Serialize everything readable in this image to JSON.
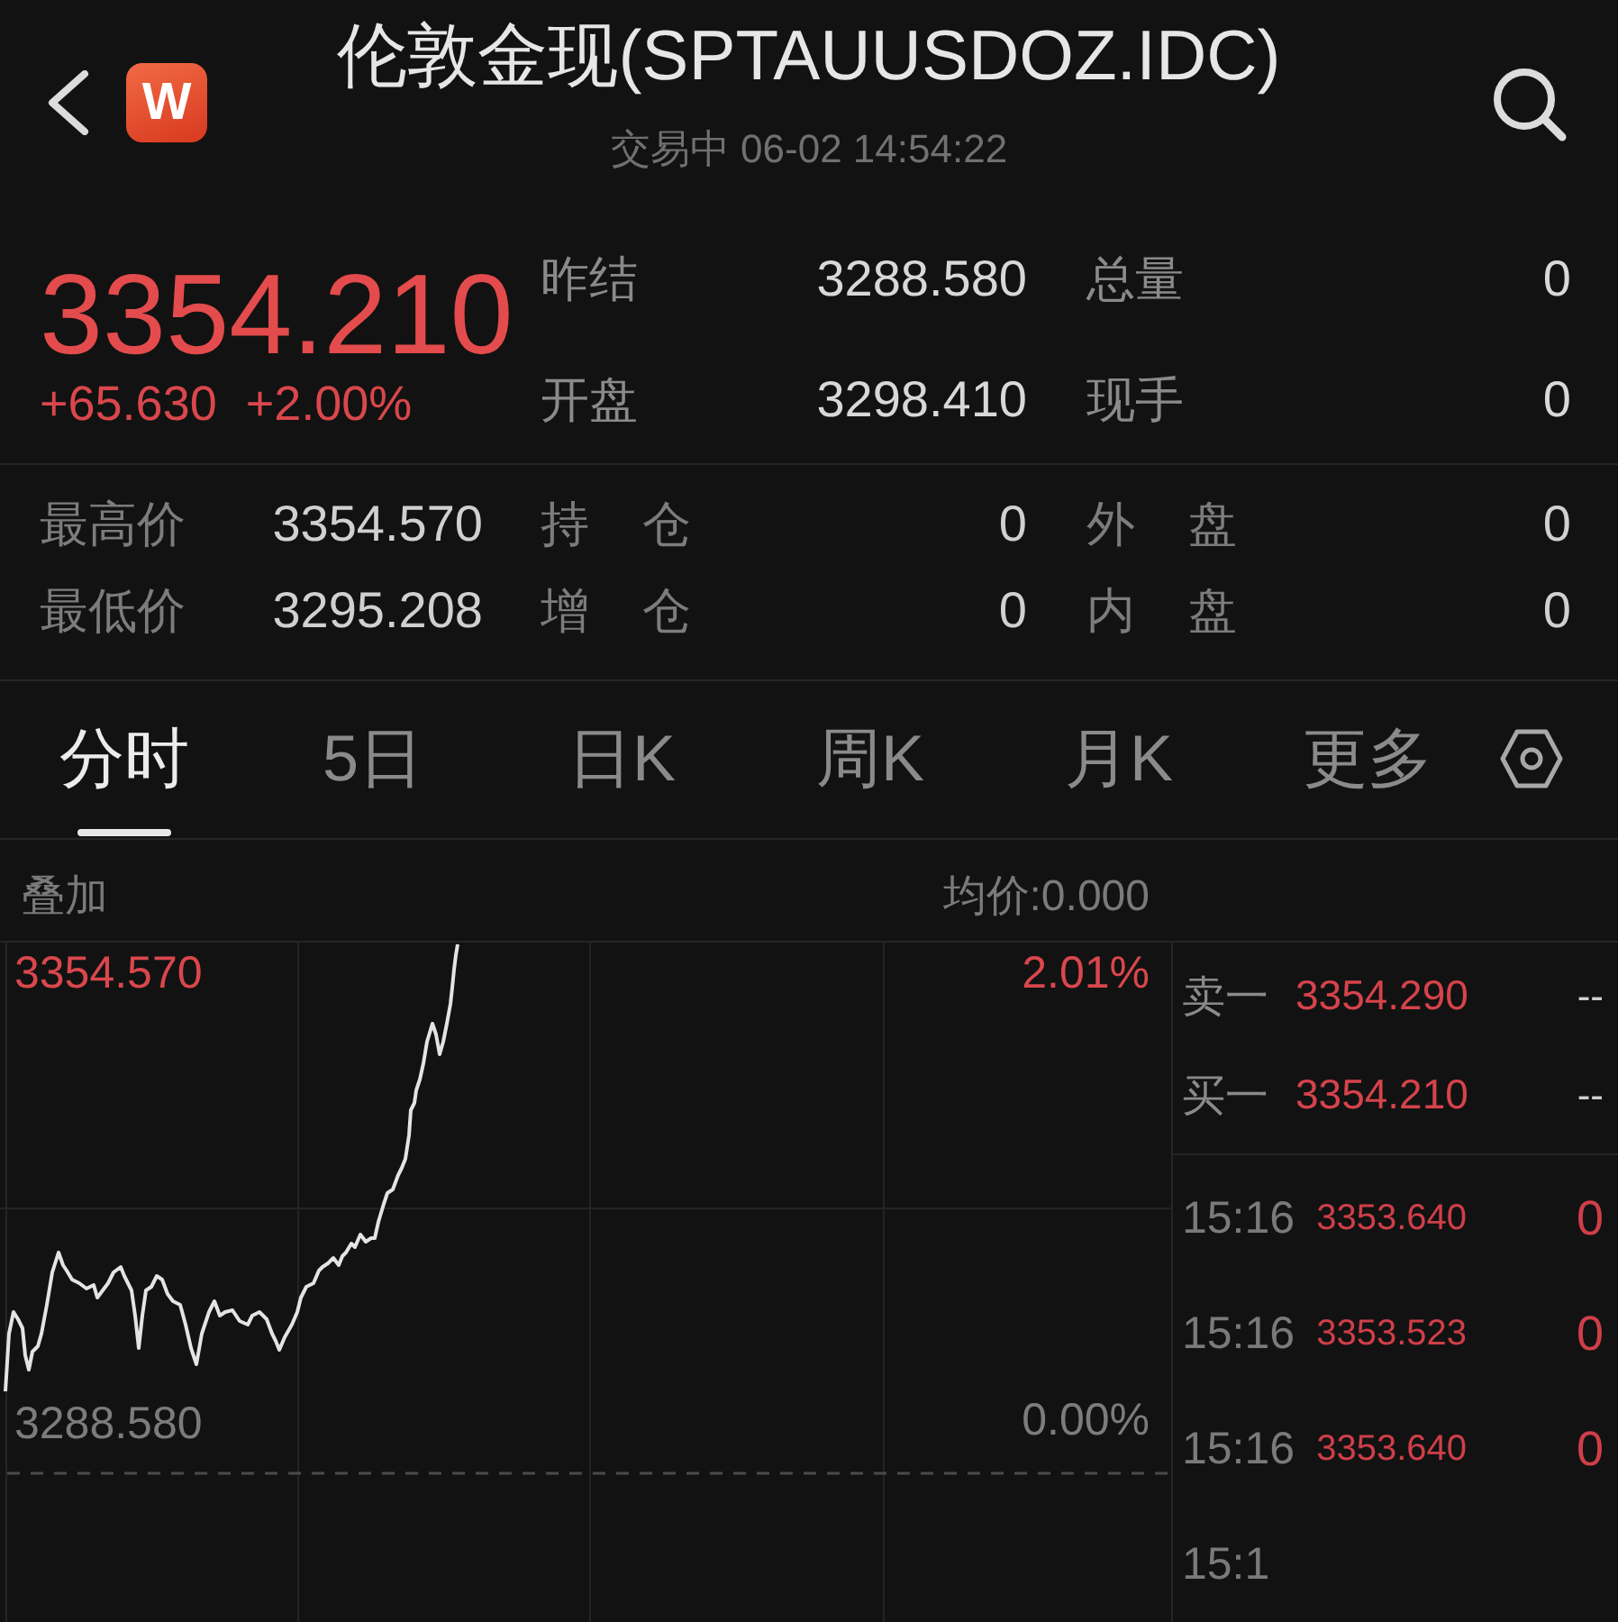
{
  "header": {
    "logo_text": "W",
    "title": "伦敦金现(SPTAUUSDOZ.IDC)",
    "status": "交易中 06-02 14:54:22"
  },
  "quote": {
    "price": "3354.210",
    "change": "+65.630",
    "change_percent": "+2.00%",
    "stats": [
      {
        "label": "昨结",
        "value": "3288.580"
      },
      {
        "label": "总量",
        "value": "0"
      },
      {
        "label": "开盘",
        "value": "3298.410"
      },
      {
        "label": "现手",
        "value": "0"
      }
    ]
  },
  "details": [
    {
      "items": [
        {
          "label": "最高价",
          "value": "3354.570"
        },
        {
          "label": "持 仓",
          "value": "0"
        },
        {
          "label": "外 盘",
          "value": "0"
        }
      ]
    },
    {
      "items": [
        {
          "label": "最低价",
          "value": "3295.208"
        },
        {
          "label": "增 仓",
          "value": "0"
        },
        {
          "label": "内 盘",
          "value": "0"
        }
      ]
    }
  ],
  "tabs": [
    {
      "label": "分时",
      "selected": true
    },
    {
      "label": "5日",
      "selected": false
    },
    {
      "label": "日K",
      "selected": false
    },
    {
      "label": "周K",
      "selected": false
    },
    {
      "label": "月K",
      "selected": false
    },
    {
      "label": "更多",
      "selected": false
    }
  ],
  "chart": {
    "overlay_label": "叠加",
    "average": "均价:0.000",
    "high_price": "3354.570",
    "high_percent": "2.01%",
    "base_price": "3288.580",
    "base_percent": "0.00%"
  },
  "order_book": [
    {
      "label": "卖一",
      "price": "3354.290",
      "volume": "--"
    },
    {
      "label": "买一",
      "price": "3354.210",
      "volume": "--"
    }
  ],
  "trades": [
    {
      "time": "15:16",
      "price": "3353.640",
      "volume": "0"
    },
    {
      "time": "15:16",
      "price": "3353.523",
      "volume": "0"
    },
    {
      "time": "15:16",
      "price": "3353.640",
      "volume": "0"
    },
    {
      "time": "15:1"
    }
  ]
}
